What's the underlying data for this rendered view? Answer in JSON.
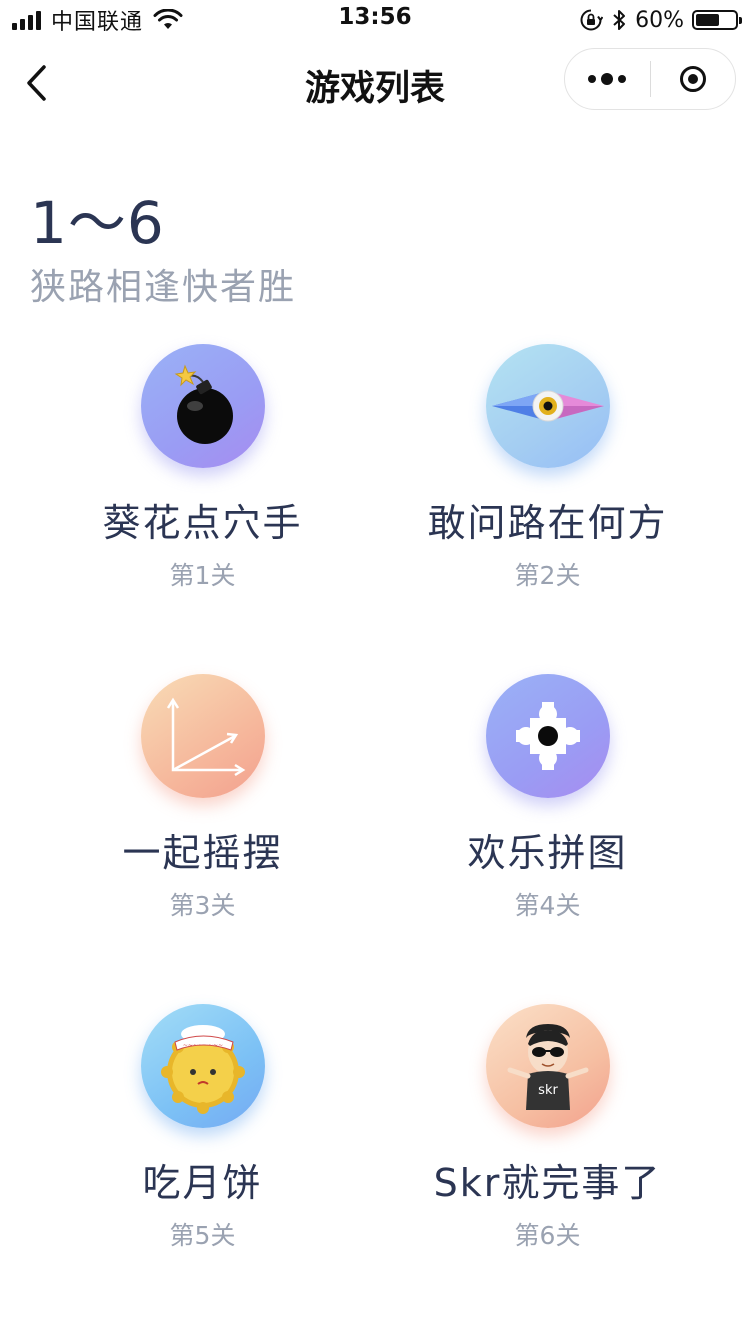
{
  "status_bar": {
    "carrier": "中国联通",
    "time": "13:56",
    "battery_percent": "60%",
    "battery_level": 0.6
  },
  "nav": {
    "title": "游戏列表"
  },
  "section": {
    "range": "1～6",
    "subtitle": "狭路相逢快者胜"
  },
  "games": [
    {
      "name": "葵花点穴手",
      "level": "第1关",
      "icon": "bomb-icon",
      "accent": "#9a9cf4"
    },
    {
      "name": "敢问路在何方",
      "level": "第2关",
      "icon": "compass-eye-icon",
      "accent": "#a4cdf2"
    },
    {
      "name": "一起摇摆",
      "level": "第3关",
      "icon": "axis-chart-icon",
      "accent": "#f6b89c"
    },
    {
      "name": "欢乐拼图",
      "level": "第4关",
      "icon": "puzzle-icon",
      "accent": "#9a9cf4"
    },
    {
      "name": "吃月饼",
      "level": "第5关",
      "icon": "mooncake-icon",
      "accent": "#7cc1f5"
    },
    {
      "name": "Skr就完事了",
      "level": "第6关",
      "icon": "sunglasses-guy-icon",
      "accent": "#f6c0a3"
    }
  ]
}
